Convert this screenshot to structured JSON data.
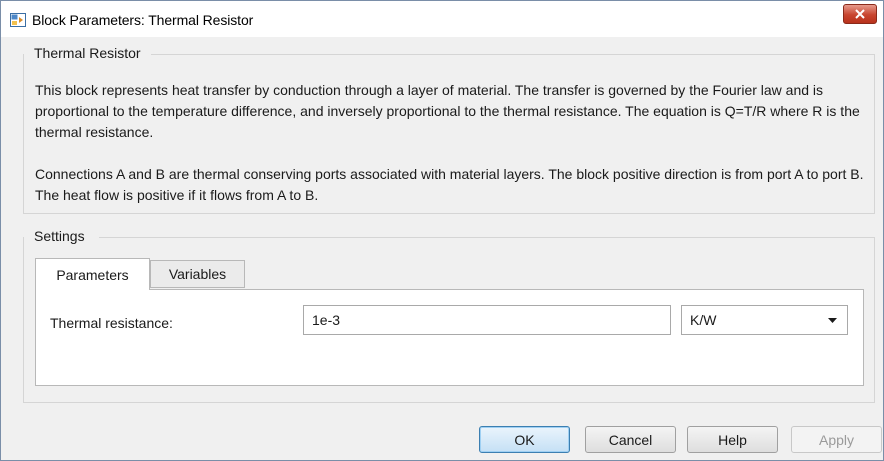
{
  "window": {
    "title": "Block Parameters: Thermal Resistor",
    "app_icon": "simulink-block-icon",
    "close_icon": "close-icon"
  },
  "block_group": {
    "title": "Thermal Resistor",
    "description_1": "This block represents heat transfer by conduction through a layer of material. The transfer is governed by the Fourier law and is proportional to the temperature difference, and inversely proportional to the thermal resistance. The equation is Q=T/R where R is the thermal resistance.",
    "description_2": "Connections A and B are thermal conserving ports associated with material layers. The block positive direction is from port A to port B. The heat flow is positive if it flows from A to B."
  },
  "settings": {
    "title": "Settings",
    "tabs": [
      {
        "label": "Parameters",
        "active": true
      },
      {
        "label": "Variables",
        "active": false
      }
    ],
    "parameters": {
      "thermal_resistance_label": "Thermal resistance:",
      "thermal_resistance_value": "1e-3",
      "unit_value": "K/W",
      "unit_icon": "chevron-down-icon"
    }
  },
  "buttons": {
    "ok": "OK",
    "cancel": "Cancel",
    "help": "Help",
    "apply": "Apply"
  },
  "colors": {
    "close_button": "#c8452f",
    "default_button_border": "#3c7fb1",
    "dialog_background": "#f0f0f0"
  }
}
